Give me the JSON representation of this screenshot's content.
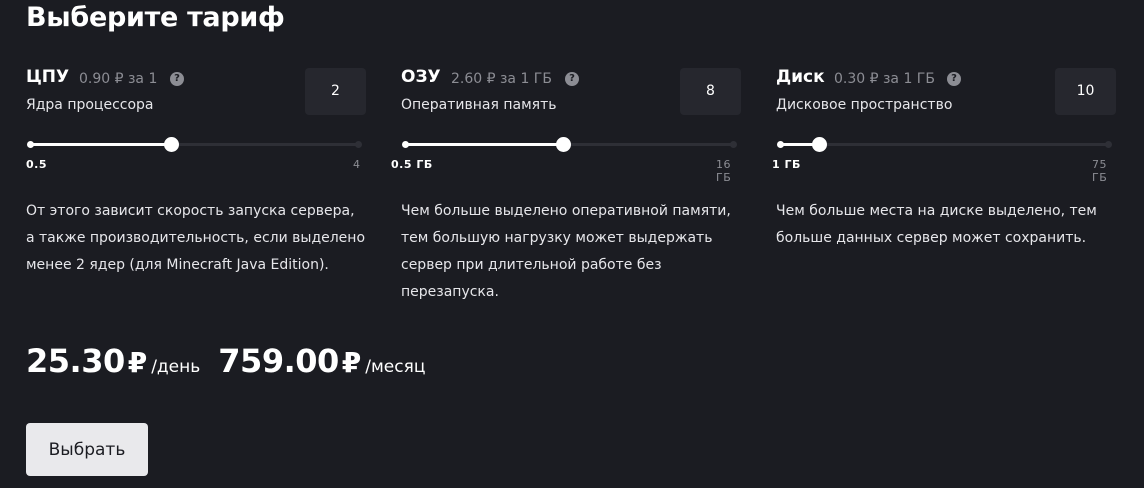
{
  "title": "Выберите тариф",
  "currency_symbol": "₽",
  "resources": [
    {
      "name": "ЦПУ",
      "price": "0.90 ₽ за 1",
      "subtitle": "Ядра процессора",
      "value": "2",
      "min_label": "0.5",
      "max_label": "4",
      "level": 0.43,
      "description": "От этого зависит скорость запуска сервера, а также производительность, если выделено менее 2 ядер (для Minecraft Java Edition)."
    },
    {
      "name": "ОЗУ",
      "price": "2.60 ₽ за 1 ГБ",
      "subtitle": "Оперативная память",
      "value": "8",
      "min_label": "0.5 ГБ",
      "max_label": "16 ГБ",
      "level": 0.48,
      "description": "Чем больше выделено оперативной памяти, тем большую нагрузку может выдержать сервер при длительной работе без перезапуска."
    },
    {
      "name": "Диск",
      "price": "0.30 ₽ за 1 ГБ",
      "subtitle": "Дисковое пространство",
      "value": "10",
      "min_label": "1 ГБ",
      "max_label": "75 ГБ",
      "level": 0.12,
      "description": "Чем больше места на диске выделено, тем больше данных сервер может сохранить."
    }
  ],
  "totals": {
    "daily_amount": "25.30",
    "daily_unit": "/день",
    "monthly_amount": "759.00",
    "monthly_unit": "/месяц"
  },
  "select_button_label": "Выбрать",
  "icons": {
    "help": "question-circle-icon"
  },
  "colors": {
    "background": "#1b1c22",
    "text": "#ffffff",
    "muted": "#8c8d94",
    "box": "#26272e",
    "track": "#2e2f36",
    "button": "#e9e9ec"
  }
}
